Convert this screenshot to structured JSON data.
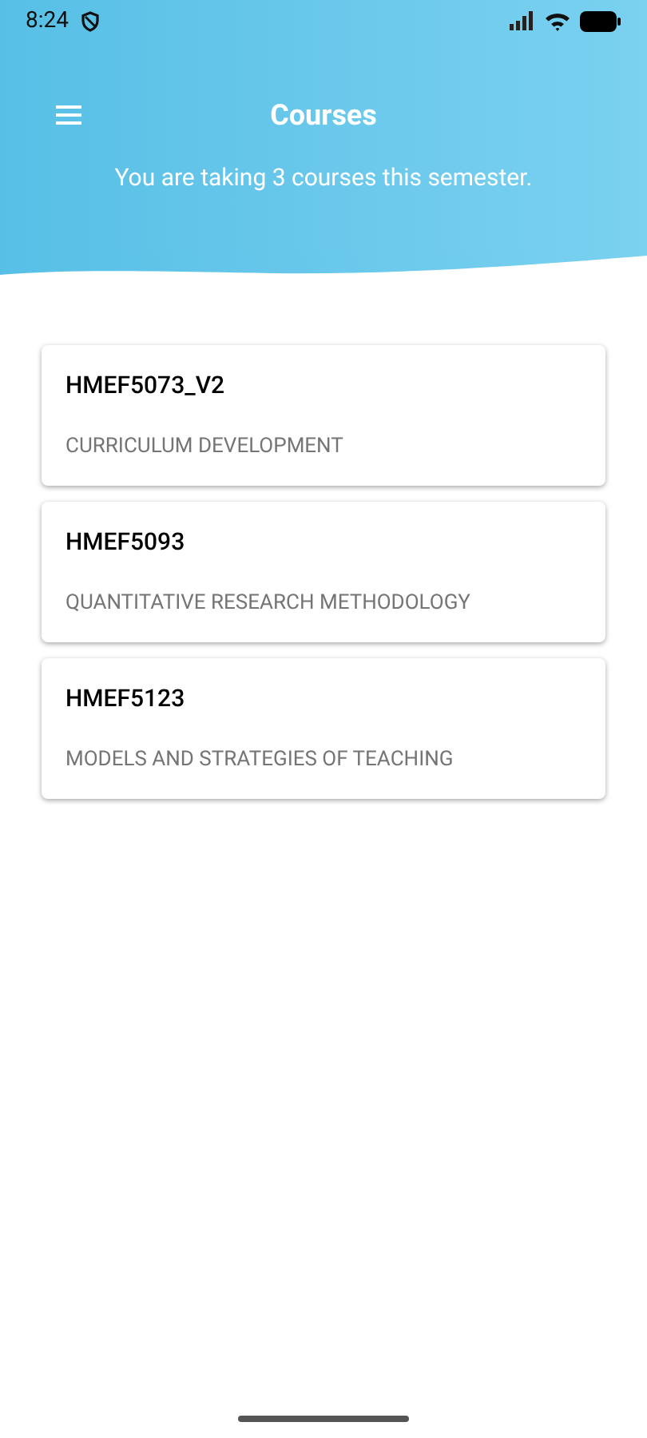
{
  "status_bar": {
    "time": "8:24"
  },
  "header": {
    "title": "Courses",
    "subtitle": "You are taking 3 courses this semester."
  },
  "courses": [
    {
      "code": "HMEF5073_V2",
      "name": "CURRICULUM DEVELOPMENT"
    },
    {
      "code": "HMEF5093",
      "name": "QUANTITATIVE RESEARCH METHODOLOGY"
    },
    {
      "code": "HMEF5123",
      "name": "MODELS AND STRATEGIES OF TEACHING"
    }
  ]
}
